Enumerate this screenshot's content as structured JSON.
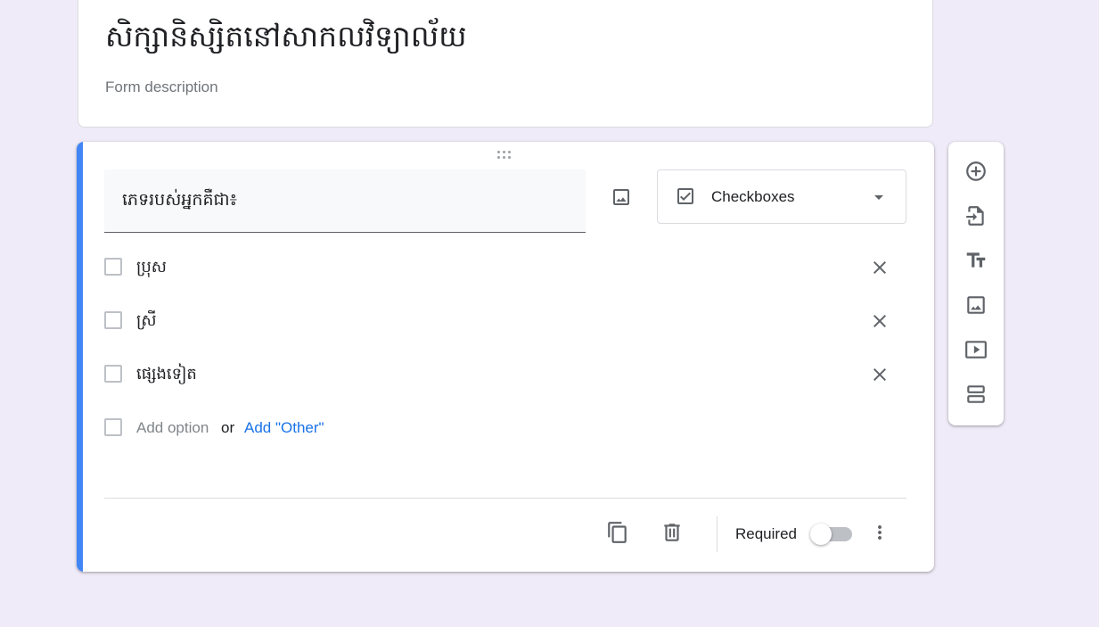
{
  "form": {
    "title": "សិក្សានិស្សិតនៅសាកលវិទ្យាល័យ",
    "description_placeholder": "Form description"
  },
  "question": {
    "text": "ភេទរបស់អ្នកគឺជា៖",
    "type_label": "Checkboxes",
    "options": [
      {
        "label": "ប្រុស"
      },
      {
        "label": "ស្រី"
      },
      {
        "label": "ផ្សេងទៀត"
      }
    ],
    "add_option_label": "Add option",
    "or_label": "or",
    "add_other_label": "Add \"Other\"",
    "required_label": "Required",
    "required": false
  },
  "colors": {
    "accent": "#4285f4",
    "link": "#1a73e8",
    "background": "#f0ebf8"
  },
  "toolbar": {
    "icons": [
      "add-question-icon",
      "import-questions-icon",
      "add-title-icon",
      "add-image-icon",
      "add-video-icon",
      "add-section-icon"
    ]
  }
}
